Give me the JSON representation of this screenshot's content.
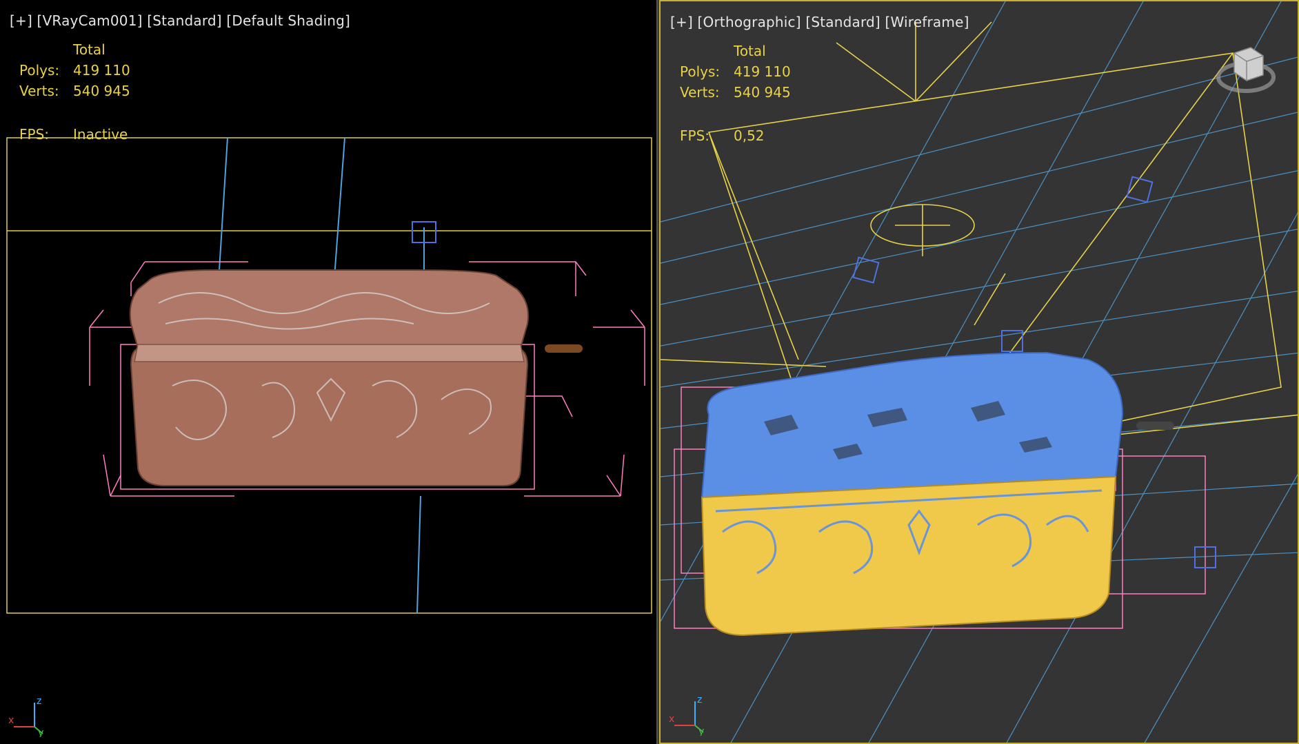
{
  "viewports": {
    "left": {
      "menu_plus": "[+]",
      "camera": "[VRayCam001]",
      "preset": "[Standard]",
      "shading": "[Default Shading]",
      "stats": {
        "total_label": "Total",
        "polys_label": "Polys:",
        "polys_value": "419 110",
        "verts_label": "Verts:",
        "verts_value": "540 945",
        "fps_label": "FPS:",
        "fps_value": "Inactive"
      }
    },
    "right": {
      "menu_plus": "[+]",
      "camera": "[Orthographic]",
      "preset": "[Standard]",
      "shading": "[Wireframe]",
      "stats": {
        "total_label": "Total",
        "polys_label": "Polys:",
        "polys_value": "419 110",
        "verts_label": "Verts:",
        "verts_value": "540 945",
        "fps_label": "FPS:",
        "fps_value": "0,52"
      }
    }
  },
  "colors": {
    "stats_text": "#e8d24a",
    "label_text": "#e6e6e6",
    "active_border": "#c9b035",
    "safe_frame": "#e0d04a",
    "light_lines": "#4fa3e0",
    "bbox": "#ff7fbf",
    "box_terracotta": "#a86e5c",
    "wire_blue": "#5b8fe6",
    "wire_gold": "#f0c84a"
  },
  "icons": [
    "axis-tripod-icon",
    "viewcube-icon"
  ]
}
